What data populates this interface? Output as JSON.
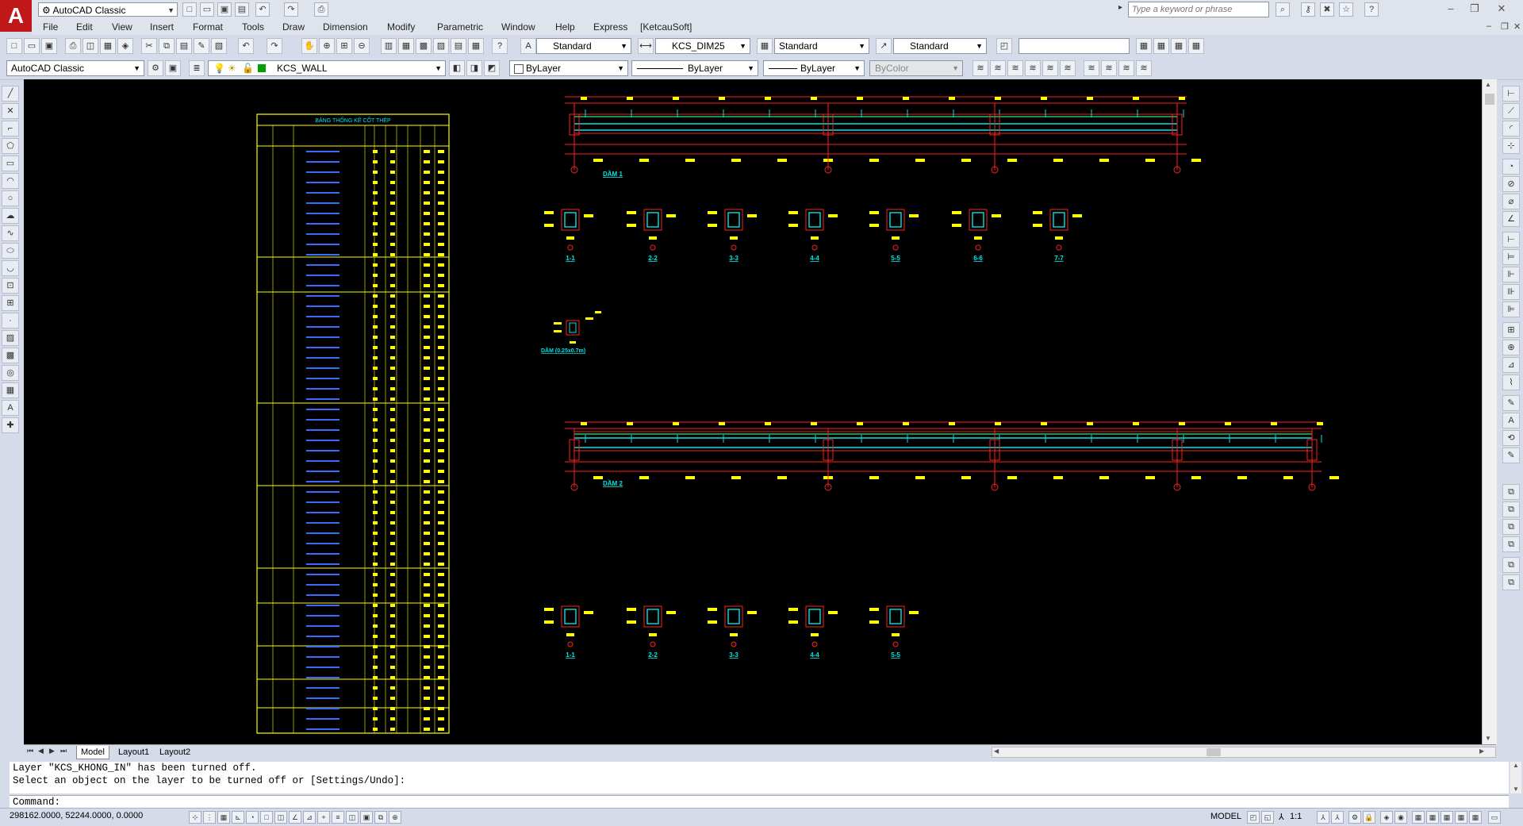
{
  "app": {
    "workspace_combo": "AutoCAD Classic",
    "search_placeholder": "Type a keyword or phrase"
  },
  "menubar": {
    "items": [
      "File",
      "Edit",
      "View",
      "Insert",
      "Format",
      "Tools",
      "Draw",
      "Dimension",
      "Modify",
      "Parametric",
      "Window",
      "Help",
      "Express",
      "[KetcauSoft]"
    ]
  },
  "styles_toolbar": {
    "text_style": "Standard",
    "dim_style": "KCS_DIM25",
    "table_style": "Standard",
    "mleader_style": "Standard"
  },
  "layers_toolbar": {
    "workspace": "AutoCAD Classic",
    "current_layer": "KCS_WALL",
    "color": "ByLayer",
    "linetype": "ByLayer",
    "lineweight": "ByLayer",
    "plotstyle": "ByColor",
    "layer_color_hex": "#00a000"
  },
  "drawing": {
    "schedule_title": "BẢNG THỐNG KÊ CỐT THÉP",
    "beam1_label": "DẦM 1",
    "beam2_label": "DẦM 2",
    "section_labels_row1": [
      "1-1",
      "2-2",
      "3-3",
      "4-4",
      "5-5",
      "6-6",
      "7-7"
    ],
    "section_labels_row2": [
      "1-1",
      "2-2",
      "3-3",
      "4-4",
      "5-5"
    ],
    "detail_label": "DẦM (0.25x0.7m)"
  },
  "tabs": [
    "Model",
    "Layout1",
    "Layout2"
  ],
  "command": {
    "history": [
      "Layer \"KCS_KHONG_IN\" has been turned off.",
      "Select an object on the layer to be turned off or [Settings/Undo]:"
    ],
    "prompt": "Command:"
  },
  "status": {
    "coordinates": "298162.0000, 52244.0000, 0.0000",
    "space": "MODEL",
    "scale": "1:1"
  },
  "colors": {
    "canvas": "#000000",
    "dim_yellow": "#ffff00",
    "line_red": "#ff2020",
    "rebar_cyan": "#00e5e5",
    "accent_green": "#2ee87a"
  }
}
